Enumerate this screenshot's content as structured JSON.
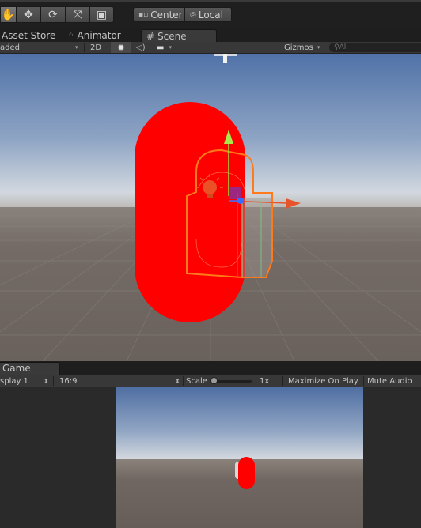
{
  "toolbar": {
    "tools": [
      {
        "name": "hand",
        "glyph": "✋"
      },
      {
        "name": "move",
        "glyph": "✥"
      },
      {
        "name": "rotate",
        "glyph": "⟳"
      },
      {
        "name": "scale",
        "glyph": "⤧"
      },
      {
        "name": "rect",
        "glyph": "▣"
      }
    ],
    "pivot_label": "Center",
    "rotation_label": "Local"
  },
  "tabs": {
    "asset_store": "Asset Store",
    "animator": "Animator",
    "scene": "Scene"
  },
  "scene_toolbar": {
    "shading_mode": "aded",
    "mode_2d": "2D",
    "gizmos_label": "Gizmos",
    "search_placeholder": "All"
  },
  "game_panel": {
    "tab_label": "Game",
    "display": "splay 1",
    "aspect": "16:9",
    "scale_label": "Scale",
    "scale_value": "1x",
    "scale_slider_position": 0,
    "maximize_on_play": "Maximize On Play",
    "mute_audio": "Mute Audio"
  },
  "colors": {
    "capsule": "#ff0000",
    "selection_outline": "#ff7a1a",
    "gizmo_y": "#a8e84a",
    "gizmo_x": "#e8542a",
    "gizmo_z": "#3a6bff",
    "sky_top": "#5072a8",
    "ground": "#716762"
  }
}
